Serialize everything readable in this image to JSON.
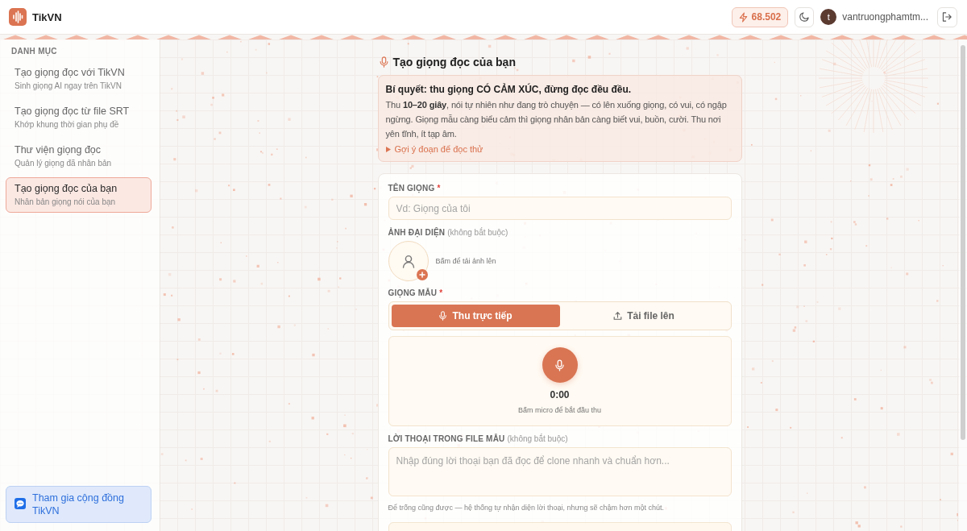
{
  "header": {
    "brand": "TikVN",
    "credits": "68.502",
    "user": {
      "initial": "t",
      "name": "vantruongphamtm..."
    }
  },
  "sidebar": {
    "heading": "DANH MỤC",
    "items": [
      {
        "title": "Tạo giọng đọc với TikVN",
        "subtitle": "Sinh giọng AI ngay trên TikVN",
        "selected": false
      },
      {
        "title": "Tạo giọng đọc từ file SRT",
        "subtitle": "Khớp khung thời gian phụ đề",
        "selected": false
      },
      {
        "title": "Thư viện giọng đọc",
        "subtitle": "Quản lý giọng đã nhân bản",
        "selected": false
      },
      {
        "title": "Tạo giọng đọc của bạn",
        "subtitle": "Nhân bản giọng nói của bạn",
        "selected": true
      }
    ],
    "community_link": "Tham gia cộng đồng TikVN"
  },
  "main": {
    "title": "Tạo giọng đọc của bạn",
    "tip": {
      "heading": "Bí quyết: thu giọng CÓ CẢM XÚC, đừng đọc đều đều.",
      "body": "Thu **10–20 giây**, nói tự nhiên như đang trò chuyện — có lên xuống giọng, có vui, có ngập ngừng. Giọng mẫu càng biểu cảm thì giọng nhân bản càng biết vui, buồn, cười. Thu nơi yên tĩnh, ít tạp âm.",
      "toggle": {
        "label": "Gợi ý đoạn để đọc thử",
        "expanded": false
      }
    },
    "form": {
      "fields": [
        {
          "kind": "text",
          "label": "TÊN GIỌNG",
          "required_mark": "*",
          "placeholder": "Vd: Giọng của tôi"
        },
        {
          "kind": "avatar",
          "label": "ẢNH ĐẠI DIỆN",
          "note": "(không bắt buộc)",
          "hint": "Bấm để tải ảnh lên"
        },
        {
          "kind": "voice_sample",
          "label": "GIỌNG MẪU",
          "required_mark": "*",
          "tabs": [
            {
              "kind": "record",
              "label": "Thu trực tiếp",
              "selected": true
            },
            {
              "kind": "upload",
              "label": "Tải file lên",
              "selected": false
            }
          ],
          "timer": "0:00",
          "hint": "Bấm micro để bắt đầu thu"
        },
        {
          "kind": "textarea",
          "label": "LỜI THOẠI TRONG FILE MẪU",
          "note": "(không bắt buộc)",
          "placeholder": "Nhập đúng lời thoại bạn đã đọc để clone nhanh và chuẩn hơn...",
          "help": "Để trống cũng được — hệ thống tự nhận diện lời thoại, nhưng sẽ chậm hơn một chút."
        },
        {
          "kind": "panel"
        }
      ]
    }
  }
}
